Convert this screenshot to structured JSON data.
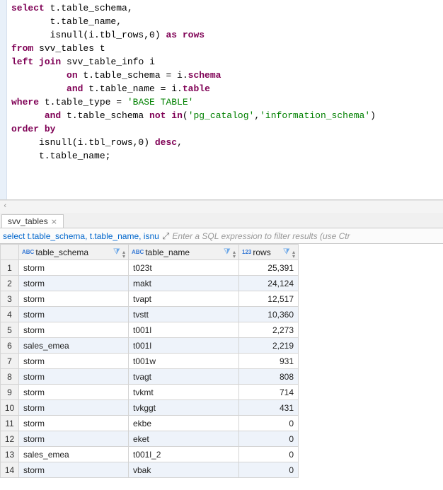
{
  "editor": {
    "sql_html": "<span class=\"kw\">select</span> t.table_schema,\n       t.table_name,\n       isnull(i.tbl_rows,0) <span class=\"kw\">as</span> <span class=\"kw\">rows</span>\n<span class=\"kw\">from</span> svv_tables t\n<span class=\"kw\">left</span> <span class=\"kw\">join</span> svv_table_info i\n          <span class=\"kw\">on</span> t.table_schema = i.<span class=\"kw\">schema</span>\n          <span class=\"kw\">and</span> t.table_name = i.<span class=\"kw\">table</span>\n<span class=\"kw\">where</span> t.table_type = <span class=\"str\">'BASE TABLE'</span>\n      <span class=\"kw\">and</span> t.table_schema <span class=\"kw\">not</span> <span class=\"kw\">in</span>(<span class=\"str\">'pg_catalog'</span>,<span class=\"str\">'information_schema'</span>)\n<span class=\"kw\">order</span> <span class=\"kw\">by</span>\n     isnull(i.tbl_rows,0) <span class=\"kw\">desc</span>,\n     t.table_name;",
    "scroll_glyph": "‹"
  },
  "tab": {
    "label": "svv_tables",
    "close_glyph": "⨯"
  },
  "filter": {
    "sql_preview": "select t.table_schema, t.table_name, isnull(i.tbl",
    "expand_glyph": "⤢",
    "placeholder": "Enter a SQL expression to filter results (use Ctr"
  },
  "grid": {
    "columns": [
      {
        "name": "table_schema",
        "type_label": "ABC"
      },
      {
        "name": "table_name",
        "type_label": "ABC"
      },
      {
        "name": "rows",
        "type_label": "123"
      }
    ],
    "funnel_glyph": "⧩",
    "sort_up": "▴",
    "sort_down": "▾",
    "rows": [
      {
        "n": "1",
        "schema": "storm",
        "name": "t023t",
        "rows_fmt": "25,391"
      },
      {
        "n": "2",
        "schema": "storm",
        "name": "makt",
        "rows_fmt": "24,124"
      },
      {
        "n": "3",
        "schema": "storm",
        "name": "tvapt",
        "rows_fmt": "12,517"
      },
      {
        "n": "4",
        "schema": "storm",
        "name": "tvstt",
        "rows_fmt": "10,360"
      },
      {
        "n": "5",
        "schema": "storm",
        "name": "t001l",
        "rows_fmt": "2,273"
      },
      {
        "n": "6",
        "schema": "sales_emea",
        "name": "t001l",
        "rows_fmt": "2,219"
      },
      {
        "n": "7",
        "schema": "storm",
        "name": "t001w",
        "rows_fmt": "931"
      },
      {
        "n": "8",
        "schema": "storm",
        "name": "tvagt",
        "rows_fmt": "808"
      },
      {
        "n": "9",
        "schema": "storm",
        "name": "tvkmt",
        "rows_fmt": "714"
      },
      {
        "n": "10",
        "schema": "storm",
        "name": "tvkggt",
        "rows_fmt": "431"
      },
      {
        "n": "11",
        "schema": "storm",
        "name": "ekbe",
        "rows_fmt": "0"
      },
      {
        "n": "12",
        "schema": "storm",
        "name": "eket",
        "rows_fmt": "0"
      },
      {
        "n": "13",
        "schema": "sales_emea",
        "name": "t001l_2",
        "rows_fmt": "0"
      },
      {
        "n": "14",
        "schema": "storm",
        "name": "vbak",
        "rows_fmt": "0"
      }
    ]
  }
}
